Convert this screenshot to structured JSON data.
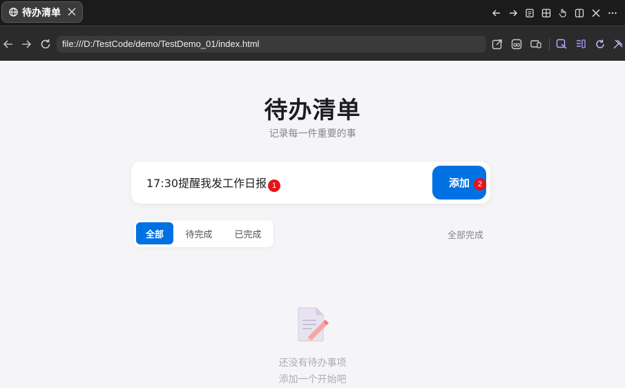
{
  "browser": {
    "tab_title": "待办清单",
    "url": "file:///D:/TestCode/demo/TestDemo_01/index.html"
  },
  "page": {
    "title": "待办清单",
    "subtitle": "记录每一件重要的事"
  },
  "input": {
    "value": "17:30提醒我发工作日报",
    "add_label": "添加"
  },
  "markers": {
    "first": "1",
    "second": "2"
  },
  "filters": {
    "all": "全部",
    "pending": "待完成",
    "done": "已完成",
    "active": "all"
  },
  "complete_all_label": "全部完成",
  "empty_state": {
    "line1": "还没有待办事项",
    "line2": "添加一个开始吧"
  },
  "colors": {
    "accent": "#0071e3",
    "marker": "#e5141b",
    "background": "#f5f5f7"
  }
}
